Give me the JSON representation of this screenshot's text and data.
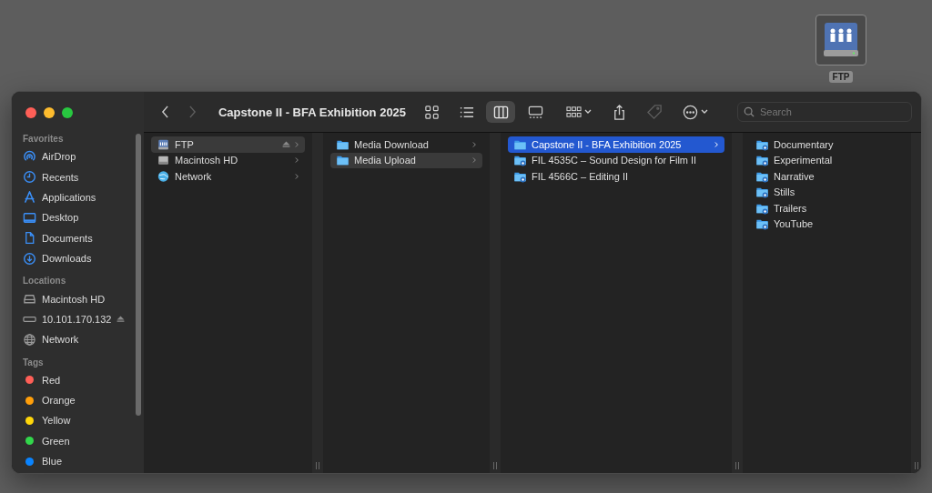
{
  "desktop_icon": {
    "label": "FTP"
  },
  "window": {
    "title": "Capstone II - BFA Exhibition 2025"
  },
  "toolbar": {
    "back": {
      "disabled": false
    },
    "forward": {
      "disabled": true
    },
    "view_modes": [
      {
        "kind": "icons",
        "selected": false
      },
      {
        "kind": "list",
        "selected": false
      },
      {
        "kind": "columns",
        "selected": true
      },
      {
        "kind": "gallery",
        "selected": false
      }
    ],
    "actions": [
      {
        "kind": "group",
        "menu": true,
        "disabled": false
      },
      {
        "kind": "share",
        "menu": false,
        "disabled": false
      },
      {
        "kind": "tag",
        "menu": false,
        "disabled": true
      },
      {
        "kind": "more",
        "menu": true,
        "disabled": false
      }
    ],
    "search": {
      "placeholder": "Search"
    }
  },
  "sidebar": {
    "sections": [
      {
        "heading": "Favorites",
        "items": [
          {
            "label": "AirDrop",
            "kind": "airdrop"
          },
          {
            "label": "Recents",
            "kind": "recents"
          },
          {
            "label": "Applications",
            "kind": "applications"
          },
          {
            "label": "Desktop",
            "kind": "desktop"
          },
          {
            "label": "Documents",
            "kind": "documents"
          },
          {
            "label": "Downloads",
            "kind": "downloads"
          }
        ]
      },
      {
        "heading": "Locations",
        "items": [
          {
            "label": "Macintosh HD",
            "kind": "disk"
          },
          {
            "label": "10.101.170.132",
            "kind": "server",
            "eject": true
          },
          {
            "label": "Network",
            "kind": "network"
          }
        ]
      },
      {
        "heading": "Tags",
        "items": [
          {
            "label": "Red",
            "kind": "tag",
            "color": "#ff5f57"
          },
          {
            "label": "Orange",
            "kind": "tag",
            "color": "#ff9f0a"
          },
          {
            "label": "Yellow",
            "kind": "tag",
            "color": "#ffd60a"
          },
          {
            "label": "Green",
            "kind": "tag",
            "color": "#32d74b"
          },
          {
            "label": "Blue",
            "kind": "tag",
            "color": "#0a84ff"
          }
        ]
      }
    ]
  },
  "columns": [
    {
      "active": false,
      "items": [
        {
          "label": "FTP",
          "kind": "ftp",
          "selected": true,
          "eject": true,
          "has_children": true
        },
        {
          "label": "Macintosh HD",
          "kind": "disk",
          "selected": false,
          "has_children": true
        },
        {
          "label": "Network",
          "kind": "network",
          "selected": false,
          "has_children": true
        }
      ]
    },
    {
      "active": false,
      "items": [
        {
          "label": "Media Download",
          "kind": "folder",
          "selected": false,
          "has_children": true
        },
        {
          "label": "Media Upload",
          "kind": "folder",
          "selected": true,
          "has_children": true
        }
      ]
    },
    {
      "active": true,
      "items": [
        {
          "label": "Capstone II - BFA Exhibition 2025",
          "kind": "folder",
          "selected": true,
          "has_children": true
        },
        {
          "label": "FIL 4535C – Sound Design for Film II",
          "kind": "shared_folder",
          "selected": false,
          "has_children": false
        },
        {
          "label": "FIL 4566C – Editing II",
          "kind": "shared_folder",
          "selected": false,
          "has_children": false
        }
      ]
    },
    {
      "items": [
        {
          "label": "Documentary",
          "kind": "shared_folder",
          "selected": false,
          "has_children": false
        },
        {
          "label": "Experimental",
          "kind": "shared_folder",
          "selected": false,
          "has_children": false
        },
        {
          "label": "Narrative",
          "kind": "shared_folder",
          "selected": false,
          "has_children": false
        },
        {
          "label": "Stills",
          "kind": "shared_folder",
          "selected": false,
          "has_children": false
        },
        {
          "label": "Trailers",
          "kind": "shared_folder",
          "selected": false,
          "has_children": false
        },
        {
          "label": "YouTube",
          "kind": "shared_folder",
          "selected": false,
          "has_children": false
        }
      ]
    }
  ]
}
